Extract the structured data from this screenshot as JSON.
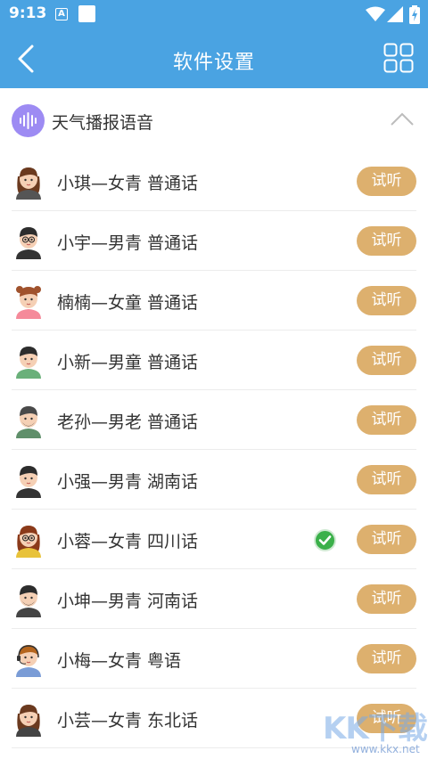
{
  "status_bar": {
    "time": "9:13",
    "notif_icon_letter": "A"
  },
  "title_bar": {
    "title": "软件设置",
    "background": "#4aa3e2"
  },
  "section": {
    "title": "天气播报语音",
    "icon_color": "#9d8bf3"
  },
  "voices": [
    {
      "label": "小琪—女青  普通话",
      "button": "试听",
      "selected": false,
      "avatar": "girl-avatar"
    },
    {
      "label": "小宇—男青  普通话",
      "button": "试听",
      "selected": false,
      "avatar": "boy-glasses-avatar"
    },
    {
      "label": "楠楠—女童  普通话",
      "button": "试听",
      "selected": false,
      "avatar": "little-girl-avatar"
    },
    {
      "label": "小新—男童  普通话",
      "button": "试听",
      "selected": false,
      "avatar": "little-boy-avatar"
    },
    {
      "label": "老孙—男老  普通话",
      "button": "试听",
      "selected": false,
      "avatar": "old-man-avatar"
    },
    {
      "label": "小强—男青  湖南话",
      "button": "试听",
      "selected": false,
      "avatar": "young-man-avatar"
    },
    {
      "label": "小蓉—女青  四川话",
      "button": "试听",
      "selected": true,
      "avatar": "woman-glasses-avatar"
    },
    {
      "label": "小坤—男青  河南话",
      "button": "试听",
      "selected": false,
      "avatar": "bearded-man-avatar"
    },
    {
      "label": "小梅—女青  粤语",
      "button": "试听",
      "selected": false,
      "avatar": "headset-woman-avatar"
    },
    {
      "label": "小芸—女青  东北话",
      "button": "试听",
      "selected": false,
      "avatar": "woman-avatar"
    }
  ],
  "colors": {
    "button": "#ddb06e",
    "check": "#3bb04a"
  },
  "watermark": {
    "main": "KK下载",
    "sub": "www.kkx.net"
  }
}
